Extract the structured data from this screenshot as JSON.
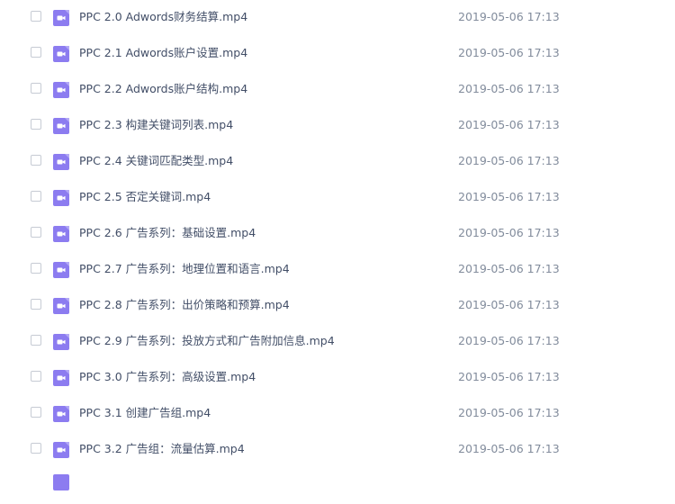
{
  "file_icon": "video-file-icon",
  "accent_color": "#8c7cf0",
  "files": [
    {
      "name": "PPC 2.0 Adwords财务结算.mp4",
      "date": "2019-05-06 17:13"
    },
    {
      "name": "PPC 2.1 Adwords账户设置.mp4",
      "date": "2019-05-06 17:13"
    },
    {
      "name": "PPC 2.2 Adwords账户结构.mp4",
      "date": "2019-05-06 17:13"
    },
    {
      "name": "PPC 2.3 构建关键词列表.mp4",
      "date": "2019-05-06 17:13"
    },
    {
      "name": "PPC 2.4 关键词匹配类型.mp4",
      "date": "2019-05-06 17:13"
    },
    {
      "name": "PPC 2.5 否定关键词.mp4",
      "date": "2019-05-06 17:13"
    },
    {
      "name": "PPC 2.6 广告系列：基础设置.mp4",
      "date": "2019-05-06 17:13"
    },
    {
      "name": "PPC 2.7 广告系列：地理位置和语言.mp4",
      "date": "2019-05-06 17:13"
    },
    {
      "name": "PPC 2.8 广告系列：出价策略和预算.mp4",
      "date": "2019-05-06 17:13"
    },
    {
      "name": "PPC 2.9 广告系列：投放方式和广告附加信息.mp4",
      "date": "2019-05-06 17:13"
    },
    {
      "name": "PPC 3.0 广告系列：高级设置.mp4",
      "date": "2019-05-06 17:13"
    },
    {
      "name": "PPC 3.1 创建广告组.mp4",
      "date": "2019-05-06 17:13"
    },
    {
      "name": "PPC 3.2 广告组：流量估算.mp4",
      "date": "2019-05-06 17:13"
    }
  ]
}
